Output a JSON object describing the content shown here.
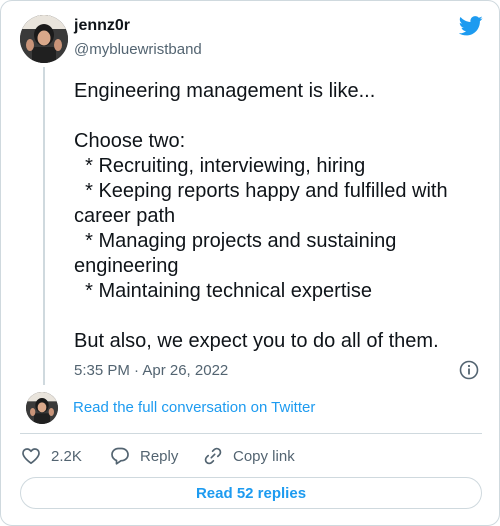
{
  "author": {
    "display_name": "jennz0r",
    "handle": "@mybluewristband"
  },
  "tweet": {
    "lines": [
      "Engineering management is like...",
      "",
      "Choose two:",
      "  * Recruiting, interviewing, hiring",
      "  * Keeping reports happy and fulfilled with",
      "career path",
      "  * Managing projects and sustaining",
      "engineering",
      "  * Maintaining technical expertise",
      "",
      "But also, we expect you to do all of them."
    ],
    "timestamp": "5:35 PM · Apr 26, 2022"
  },
  "conversation_link": "Read the full conversation on Twitter",
  "actions": {
    "like_count": "2.2K",
    "reply_label": "Reply",
    "copy_link_label": "Copy link"
  },
  "read_replies_label": "Read 52 replies",
  "colors": {
    "accent": "#1d9bf0",
    "text": "#0f1419",
    "secondary_text": "#536471",
    "border": "#cfd9de"
  }
}
